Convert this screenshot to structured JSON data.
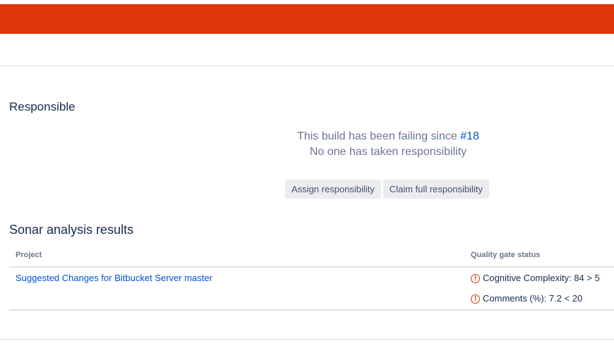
{
  "colors": {
    "banner": "#de350b",
    "link": "#0052cc",
    "error_icon": "#de350b"
  },
  "responsible": {
    "title": "Responsible",
    "failing_prefix": "This build has been failing since ",
    "failing_build": "#18",
    "no_responsibility": "No one has taken responsibility",
    "assign_button": "Assign responsibility",
    "claim_button": "Claim full responsibility"
  },
  "sonar": {
    "title": "Sonar analysis results",
    "columns": {
      "project": "Project",
      "quality_gate": "Quality gate status"
    },
    "rows": [
      {
        "project": "Suggested Changes for Bitbucket Server master",
        "statuses": [
          {
            "icon": "error-circle-icon",
            "text": "Cognitive Complexity: 84 > 5"
          },
          {
            "icon": "error-circle-icon",
            "text": "Comments (%): 7.2 < 20"
          }
        ]
      }
    ]
  }
}
